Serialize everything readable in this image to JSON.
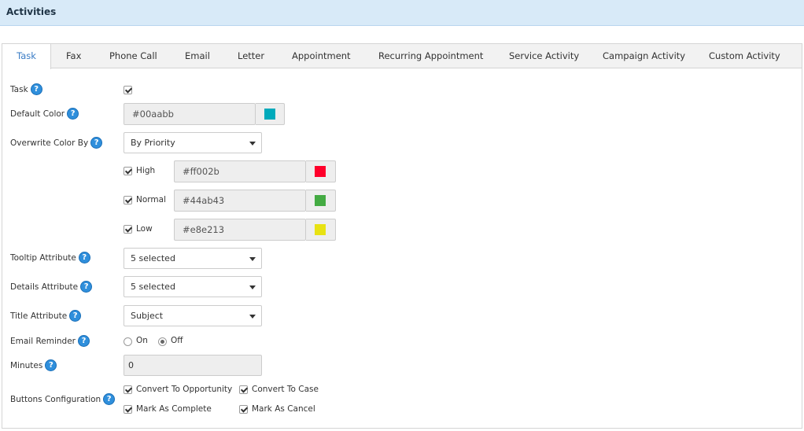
{
  "header": {
    "title": "Activities"
  },
  "tabs": [
    {
      "label": "Task"
    },
    {
      "label": "Fax"
    },
    {
      "label": "Phone Call"
    },
    {
      "label": "Email"
    },
    {
      "label": "Letter"
    },
    {
      "label": "Appointment"
    },
    {
      "label": "Recurring Appointment"
    },
    {
      "label": "Service Activity"
    },
    {
      "label": "Campaign Activity"
    },
    {
      "label": "Custom Activity"
    }
  ],
  "active_tab": "Task",
  "form": {
    "task": {
      "label": "Task",
      "checked": true
    },
    "default_color": {
      "label": "Default Color",
      "value": "#00aabb",
      "swatch": "#00aabb"
    },
    "overwrite_color_by": {
      "label": "Overwrite Color By",
      "value": "By Priority"
    },
    "priorities": [
      {
        "label": "High",
        "checked": true,
        "value": "#ff002b",
        "swatch": "#ff002b"
      },
      {
        "label": "Normal",
        "checked": true,
        "value": "#44ab43",
        "swatch": "#44ab43"
      },
      {
        "label": "Low",
        "checked": true,
        "value": "#e8e213",
        "swatch": "#e8e213"
      }
    ],
    "tooltip_attribute": {
      "label": "Tooltip Attribute",
      "value": "5 selected"
    },
    "details_attribute": {
      "label": "Details Attribute",
      "value": "5 selected"
    },
    "title_attribute": {
      "label": "Title Attribute",
      "value": "Subject"
    },
    "email_reminder": {
      "label": "Email Reminder",
      "on_label": "On",
      "off_label": "Off",
      "selected": "Off"
    },
    "minutes": {
      "label": "Minutes",
      "value": "0"
    },
    "buttons_configuration": {
      "label": "Buttons Configuration",
      "options": [
        {
          "label": "Convert To Opportunity",
          "checked": true
        },
        {
          "label": "Convert To Case",
          "checked": true
        },
        {
          "label": "Mark As Complete",
          "checked": true
        },
        {
          "label": "Mark As Cancel",
          "checked": true
        }
      ]
    }
  },
  "help_glyph": "?",
  "colors": {
    "accent": "#3a7cc5",
    "header_bg": "#d8eaf8",
    "help_icon": "#2f8fdc"
  }
}
